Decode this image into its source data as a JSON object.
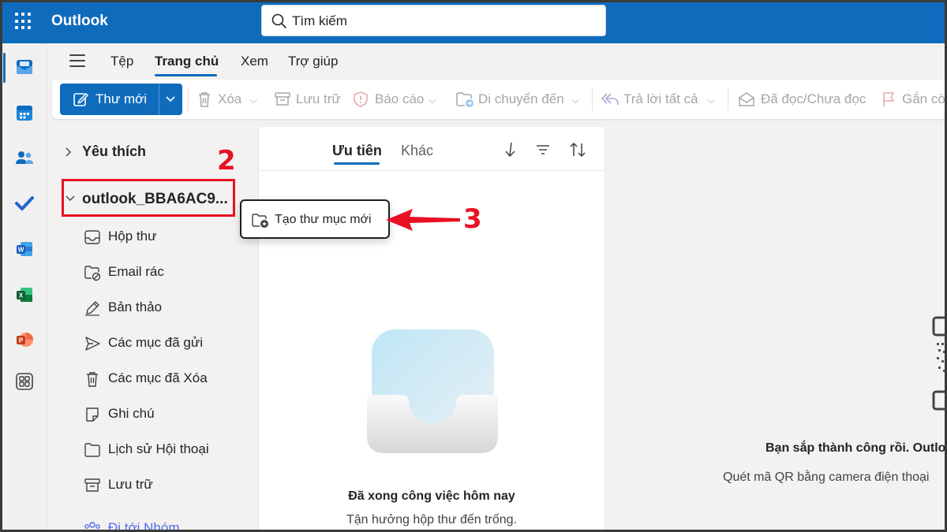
{
  "app": {
    "title": "Outlook"
  },
  "search": {
    "placeholder": "Tìm kiếm"
  },
  "menu_tabs": [
    "Tệp",
    "Trang chủ",
    "Xem",
    "Trợ giúp"
  ],
  "toolbar": {
    "new_mail": "Thư mới",
    "delete": "Xóa",
    "archive": "Lưu trữ",
    "report": "Báo cáo",
    "move_to": "Di chuyển đến",
    "reply_all": "Trả lời tất cả",
    "read_unread": "Đã đọc/Chưa đọc",
    "flag": "Gắn cờ"
  },
  "folders": {
    "favorites": "Yêu thích",
    "account": "outlook_BBA6AC9...",
    "items": [
      "Hộp thư",
      "Email rác",
      "Bản thảo",
      "Các mục đã gửi",
      "Các mục đã Xóa",
      "Ghi chú",
      "Lịch sử Hội thoại",
      "Lưu trữ"
    ],
    "groups": "Đi tới Nhóm"
  },
  "list": {
    "tab_focused": "Ưu tiên",
    "tab_other": "Khác",
    "empty_title": "Đã xong công việc hôm nay",
    "empty_subtitle": "Tận hưởng hộp thư đến trống."
  },
  "context_menu": {
    "new_folder": "Tạo thư mục mới"
  },
  "annotations": {
    "step2": "2",
    "step3": "3",
    "color": "#e81123"
  },
  "reading_pane": {
    "title": "Bạn sắp thành công rồi. Outlook",
    "subtitle": "Quét mã QR bằng camera điện thoại"
  },
  "colors": {
    "brand": "#0f6cbd",
    "background": "#f3f2f1"
  }
}
